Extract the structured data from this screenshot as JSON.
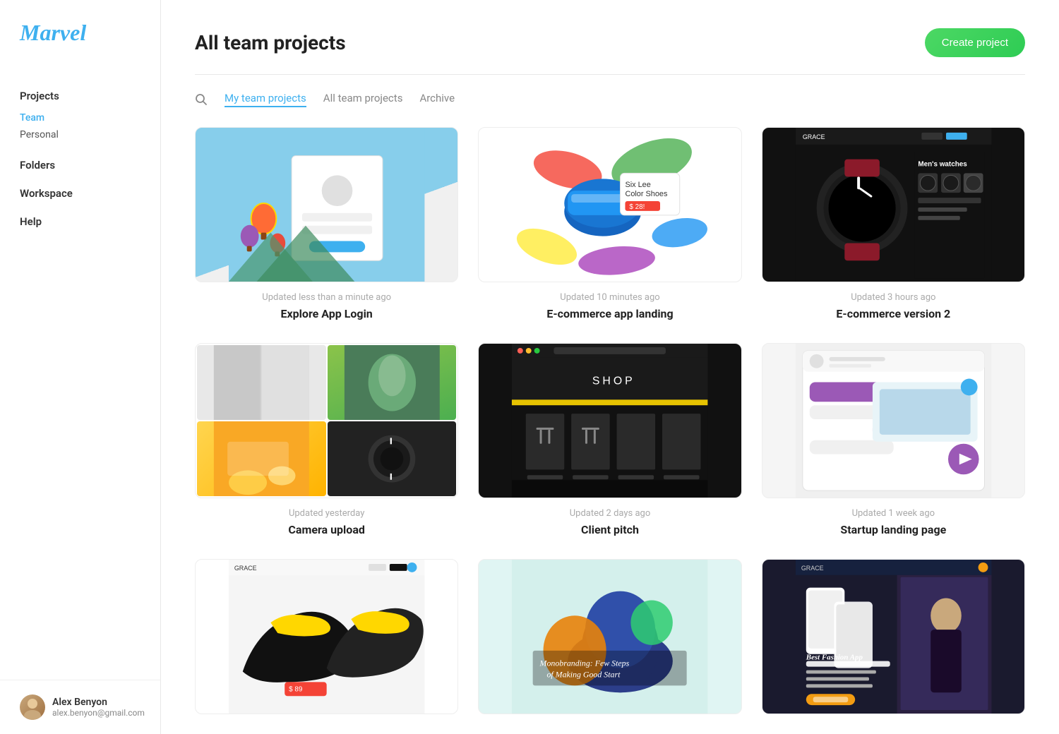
{
  "sidebar": {
    "logo": "Marvel",
    "sections": [
      {
        "label": "Projects",
        "items": [
          {
            "id": "team",
            "label": "Team",
            "active": true
          },
          {
            "id": "personal",
            "label": "Personal",
            "active": false
          }
        ]
      },
      {
        "label": "Folders",
        "standalone": true
      },
      {
        "label": "Workspace",
        "standalone": true
      },
      {
        "label": "Help",
        "standalone": true
      }
    ]
  },
  "user": {
    "name": "Alex Benyon",
    "email": "alex.benyon@gmail.com"
  },
  "header": {
    "title": "All team projects",
    "create_button": "Create project"
  },
  "tabs": [
    {
      "id": "my-team",
      "label": "My team projects",
      "active": true
    },
    {
      "id": "all-team",
      "label": "All team projects",
      "active": false
    },
    {
      "id": "archive",
      "label": "Archive",
      "active": false
    }
  ],
  "projects": [
    {
      "id": "explore-app-login",
      "name": "Explore App Login",
      "updated": "Updated less than a minute ago",
      "thumb_type": "explore"
    },
    {
      "id": "ecommerce-landing",
      "name": "E-commerce app landing",
      "updated": "Updated 10 minutes ago",
      "thumb_type": "ecommerce1"
    },
    {
      "id": "ecommerce-v2",
      "name": "E-commerce version 2",
      "updated": "Updated 3 hours ago",
      "thumb_type": "ecommerce2"
    },
    {
      "id": "camera-upload",
      "name": "Camera upload",
      "updated": "Updated yesterday",
      "thumb_type": "camera"
    },
    {
      "id": "client-pitch",
      "name": "Client pitch",
      "updated": "Updated 2 days ago",
      "thumb_type": "client"
    },
    {
      "id": "startup-landing",
      "name": "Startup landing page",
      "updated": "Updated 1 week ago",
      "thumb_type": "startup"
    },
    {
      "id": "row3a",
      "name": "",
      "updated": "",
      "thumb_type": "row3a"
    },
    {
      "id": "row3b",
      "name": "",
      "updated": "",
      "thumb_type": "row3b"
    },
    {
      "id": "row3c",
      "name": "",
      "updated": "",
      "thumb_type": "row3c"
    }
  ]
}
